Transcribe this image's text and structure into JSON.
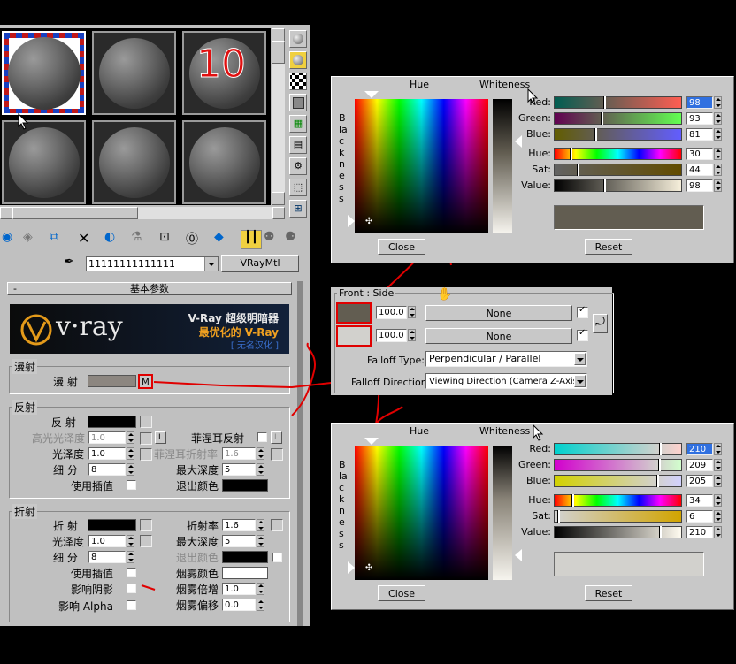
{
  "material_editor": {
    "slot_number_overlay": "10",
    "material_name": "11111111111111",
    "material_type": "VRayMtl",
    "rollout_title": "基本参数",
    "rollout_collapse": "-",
    "banner": {
      "logo_text": "v·ray",
      "line1": "V-Ray 超级明暗器",
      "line2": "最优化的 V-Ray",
      "line3": "[ 无名汉化 ]"
    },
    "diffuse": {
      "group": "漫射",
      "label": "漫 射",
      "map_button": "M",
      "color": "#8c8680"
    },
    "reflection": {
      "group": "反射",
      "reflect_label": "反 射",
      "hilight_gloss_label": "高光光泽度",
      "hilight_gloss_value": "1.0",
      "lock_btn": "L",
      "gloss_label": "光泽度",
      "gloss_value": "1.0",
      "subdivs_label": "细 分",
      "subdivs_value": "8",
      "interp_label": "使用插值",
      "fresnel_label": "菲涅耳反射",
      "fresnel_lock": "L",
      "fresnel_ior_label": "菲涅耳折射率",
      "fresnel_ior_value": "1.6",
      "max_depth_label": "最大深度",
      "max_depth_value": "5",
      "exit_color_label": "退出颜色"
    },
    "refraction": {
      "group": "折射",
      "refract_label": "折 射",
      "gloss_label": "光泽度",
      "gloss_value": "1.0",
      "subdivs_label": "细 分",
      "subdivs_value": "8",
      "interp_label": "使用插值",
      "shadows_label": "影响阴影",
      "alpha_label": "影响 Alpha",
      "ior_label": "折射率",
      "ior_value": "1.6",
      "max_depth_label": "最大深度",
      "max_depth_value": "5",
      "exit_color_label": "退出颜色",
      "fog_color_label": "烟雾颜色",
      "fog_mult_label": "烟雾倍增",
      "fog_mult_value": "1.0",
      "fog_bias_label": "烟雾偏移",
      "fog_bias_value": "0.0"
    }
  },
  "color_picker_top": {
    "hue_label": "Hue",
    "whiteness_label": "Whiteness",
    "blackness_label": "Blackness",
    "red_label": "Red:",
    "red_value": "98",
    "red": 98,
    "green_label": "Green:",
    "green_value": "93",
    "green": 93,
    "blue_label": "Blue:",
    "blue_value": "81",
    "blue": 81,
    "hue_row_label": "Hue:",
    "hue_value": "30",
    "hue": 30,
    "sat_label": "Sat:",
    "sat_value": "44",
    "sat": 44,
    "value_label": "Value:",
    "value_value": "98",
    "value": 98,
    "swatch_color": "#625d51",
    "close_label": "Close",
    "reset_label": "Reset"
  },
  "color_picker_bottom": {
    "hue_label": "Hue",
    "whiteness_label": "Whiteness",
    "blackness_label": "Blackness",
    "red_label": "Red:",
    "red_value": "210",
    "red": 210,
    "green_label": "Green:",
    "green_value": "209",
    "green": 209,
    "blue_label": "Blue:",
    "blue_value": "205",
    "blue": 205,
    "hue_row_label": "Hue:",
    "hue_value": "34",
    "hue": 34,
    "sat_label": "Sat:",
    "sat_value": "6",
    "sat": 6,
    "value_label": "Value:",
    "value_value": "210",
    "value": 210,
    "swatch_color": "#d2d1cd",
    "close_label": "Close",
    "reset_label": "Reset"
  },
  "falloff": {
    "title": "Front : Side",
    "row1_amount": "100.0",
    "row1_map": "None",
    "row1_color": "#625d51",
    "row2_amount": "100.0",
    "row2_map": "None",
    "row2_color": "#d2d1cd",
    "falloff_type_label": "Falloff Type:",
    "falloff_type_value": "Perpendicular / Parallel",
    "falloff_dir_label": "Falloff Direction:",
    "falloff_dir_value": "Viewing Direction (Camera Z-Axis)"
  }
}
